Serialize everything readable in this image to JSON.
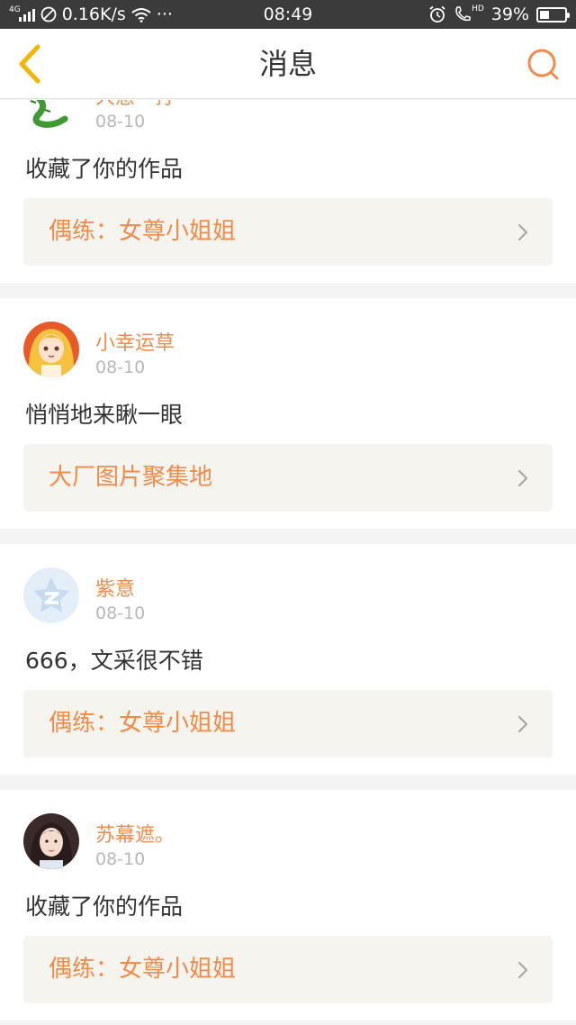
{
  "statusbar": {
    "network": "4G",
    "speed": "0.16K/s",
    "more": "···",
    "time": "08:49",
    "hd": "HD",
    "battery": "39%",
    "battery_level": 0.39
  },
  "header": {
    "title": "消息"
  },
  "messages": [
    {
      "name": "大葱一打",
      "time": "08-10",
      "text": "收藏了你的作品",
      "link": "偶练：女尊小姐姐",
      "avatar": "snake-avatar"
    },
    {
      "name": "小幸运草",
      "time": "08-10",
      "text": "悄悄地来瞅一眼",
      "link": "大厂图片聚集地",
      "avatar": "anime-girl-avatar"
    },
    {
      "name": "紫意",
      "time": "08-10",
      "text": "666，文采很不错",
      "link": "偶练：女尊小姐姐",
      "avatar": "qzone-avatar"
    },
    {
      "name": "苏幕遮。",
      "time": "08-10",
      "text": "收藏了你的作品",
      "link": "偶练：女尊小姐姐",
      "avatar": "photo-avatar"
    }
  ],
  "colors": {
    "accent": "#f28b4a",
    "back_icon": "#f2b705",
    "statusbar": "#3b3b3b"
  }
}
